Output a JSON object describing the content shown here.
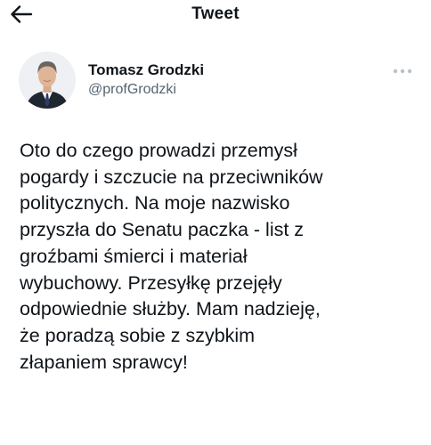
{
  "header": {
    "title": "Tweet",
    "back_icon": "arrow-left-icon"
  },
  "author": {
    "display_name": "Tomasz Grodzki",
    "handle": "@profGrodzki",
    "avatar_icon": "profile-photo"
  },
  "more_icon": "more-dots-icon",
  "tweet": {
    "text": "Oto do czego prowadzi przemysł\npogardy i szczucie na przeciwników\npolitycznych. Na moje nazwisko\nprzyszła do Senatu paczka - list z\ngroźbami śmierci i materiał\nwybuchowy. Przesyłkę przejęły\nodpowiednie służby. Mam nadzieję,\nże poradzą sobie z szybkim\nzłapaniem sprawcy!"
  },
  "colors": {
    "text_primary": "#0f1419",
    "text_secondary": "#536471",
    "background": "#ffffff"
  }
}
